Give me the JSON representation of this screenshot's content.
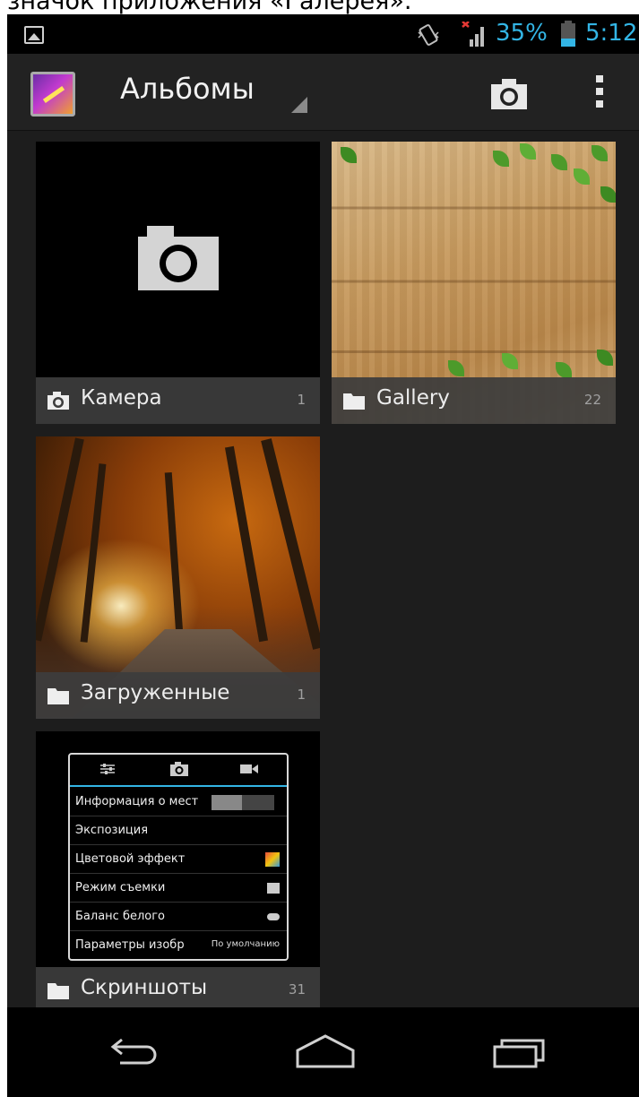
{
  "caption": "значок приложения «Галерея».",
  "status_bar": {
    "battery_percent": "35%",
    "battery_level": 0.35,
    "time": "5:12",
    "accent_color": "#33b5e5",
    "icons": [
      "gallery-notification-icon",
      "vibrate-icon",
      "no-signal-icon",
      "battery-icon"
    ]
  },
  "action_bar": {
    "title": "Альбомы",
    "icons": [
      "gallery-app-icon",
      "dropdown-icon",
      "camera-icon",
      "overflow-menu-icon"
    ]
  },
  "albums": [
    {
      "name": "Камера",
      "count": "1",
      "icon": "camera-icon"
    },
    {
      "name": "Gallery",
      "count": "22",
      "icon": "folder-icon"
    },
    {
      "name": "Загруженные",
      "count": "1",
      "icon": "folder-icon"
    },
    {
      "name": "Скриншоты",
      "count": "31",
      "icon": "folder-icon"
    }
  ],
  "screenshot_thumb": {
    "rows": [
      {
        "label": "Информация о мест"
      },
      {
        "label": "Экспозиция"
      },
      {
        "label": "Цветовой эффект"
      },
      {
        "label": "Режим съемки"
      },
      {
        "label": "Баланс белого"
      },
      {
        "label": "Параметры изобр",
        "value": "По умолчанию"
      }
    ]
  },
  "nav_bar": {
    "icons": [
      "back-icon",
      "home-icon",
      "recent-apps-icon"
    ]
  }
}
